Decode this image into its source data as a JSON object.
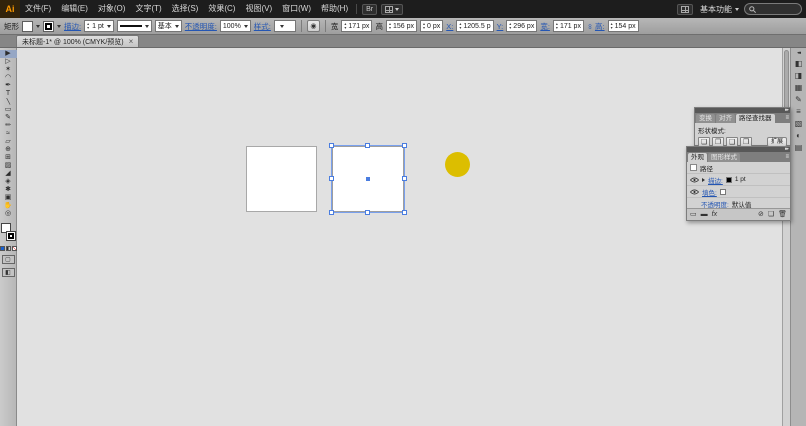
{
  "app": {
    "name": "Adobe Illustrator",
    "colors": {
      "selection_blue": "#4a7de0",
      "link_blue": "#2456b3",
      "shape_yellow": "#dcbe00",
      "canvas_gray": "#e1e1e1",
      "menubar_black": "#1d1d1d"
    }
  },
  "menu_bar": {
    "logo_text": "Ai",
    "items": [
      "文件(F)",
      "编辑(E)",
      "对象(O)",
      "文字(T)",
      "选择(S)",
      "效果(C)",
      "视图(V)",
      "窗口(W)",
      "帮助(H)"
    ],
    "bridge_label": "Br",
    "workspace_label": "基本功能",
    "search_placeholder": ""
  },
  "control_bar": {
    "selection_type": "矩形",
    "stroke_label": "描边:",
    "stroke_value": "1 pt",
    "brush_value": "基本",
    "opacity_label": "不透明度:",
    "opacity_value": "100%",
    "style_label": "样式:",
    "icons": {
      "constrain": "∞",
      "recolor": "◉"
    },
    "fields": [
      {
        "label": "宽",
        "value": "171 px"
      },
      {
        "label": "高",
        "value": "156 px"
      },
      {
        "label": "",
        "value": "0 px"
      },
      {
        "label": "X:",
        "value": "1205.5 p"
      },
      {
        "label": "Y:",
        "value": "296 px"
      },
      {
        "label": "宽:",
        "value": "171 px"
      },
      {
        "label": "高:",
        "value": "154 px"
      }
    ]
  },
  "document_tab": {
    "title": "未标题-1* @ 100% (CMYK/预览)",
    "close_label": "×"
  },
  "toolbar": {
    "tools": [
      {
        "name": "selection-tool",
        "glyph": "▶"
      },
      {
        "name": "direct-selection-tool",
        "glyph": "▷"
      },
      {
        "name": "magic-wand-tool",
        "glyph": "✶"
      },
      {
        "name": "lasso-tool",
        "glyph": "◠"
      },
      {
        "name": "pen-tool",
        "glyph": "✒"
      },
      {
        "name": "type-tool",
        "glyph": "T"
      },
      {
        "name": "line-segment-tool",
        "glyph": "╲"
      },
      {
        "name": "rectangle-tool",
        "glyph": "▭"
      },
      {
        "name": "paintbrush-tool",
        "glyph": "✎"
      },
      {
        "name": "pencil-tool",
        "glyph": "✏"
      },
      {
        "name": "width-tool",
        "glyph": "≈"
      },
      {
        "name": "free-transform-tool",
        "glyph": "▱"
      },
      {
        "name": "shape-builder-tool",
        "glyph": "⊕"
      },
      {
        "name": "mesh-tool",
        "glyph": "⊞"
      },
      {
        "name": "gradient-tool",
        "glyph": "▨"
      },
      {
        "name": "eyedropper-tool",
        "glyph": "◢"
      },
      {
        "name": "blend-tool",
        "glyph": "◈"
      },
      {
        "name": "symbol-sprayer-tool",
        "glyph": "✱"
      },
      {
        "name": "artboard-tool",
        "glyph": "▣"
      },
      {
        "name": "hand-tool",
        "glyph": "✋"
      },
      {
        "name": "zoom-tool",
        "glyph": "◎"
      }
    ]
  },
  "canvas": {
    "zoom": "100%",
    "shapes": [
      {
        "type": "rectangle",
        "fill": "#ffffff",
        "stroke": "#a8a8a8",
        "selected": false
      },
      {
        "type": "rectangle",
        "fill": "#ffffff",
        "stroke": "#9e9e9e",
        "selected": true
      },
      {
        "type": "ellipse",
        "fill": "#dcbe00",
        "selected": false
      }
    ]
  },
  "pathfinder_panel": {
    "tabs": [
      "变换",
      "对齐",
      "路径查找器"
    ],
    "active_tab": "路径查找器",
    "shape_modes_label": "形状模式:",
    "expand_button": "扩展",
    "shape_mode_icons": [
      {
        "name": "unite-icon",
        "glyph": "❏"
      },
      {
        "name": "minus-front-icon",
        "glyph": "❐"
      },
      {
        "name": "intersect-icon",
        "glyph": "❑"
      },
      {
        "name": "exclude-icon",
        "glyph": "❒"
      }
    ]
  },
  "appearance_panel": {
    "tabs": [
      "外观",
      "图形样式"
    ],
    "active_tab": "外观",
    "target_label": "路径",
    "stroke_row": {
      "label": "描边:",
      "value": "1 pt"
    },
    "fill_row": {
      "label": "填色:"
    },
    "opacity_row": {
      "label": "不透明度:",
      "value": "默认值"
    },
    "bottom_icons": [
      {
        "name": "add-new-stroke-icon",
        "glyph": "▭"
      },
      {
        "name": "add-new-fill-icon",
        "glyph": "▬"
      },
      {
        "name": "add-new-effect-icon",
        "glyph": "fx"
      },
      {
        "name": "clear-appearance-icon",
        "glyph": "⊘"
      },
      {
        "name": "duplicate-selected-item-icon",
        "glyph": "❏"
      },
      {
        "name": "delete-selected-item-icon",
        "glyph": "🗑"
      }
    ]
  },
  "dock": {
    "expand_glyph": "◂◂",
    "icons": [
      {
        "name": "color-panel-icon",
        "glyph": "◧"
      },
      {
        "name": "color-guide-panel-icon",
        "glyph": "◨"
      },
      {
        "name": "swatches-panel-icon",
        "glyph": "▦"
      },
      {
        "name": "brushes-panel-icon",
        "glyph": "✎"
      },
      {
        "name": "stroke-panel-icon",
        "glyph": "≡"
      },
      {
        "name": "gradient-panel-icon",
        "glyph": "▧"
      },
      {
        "name": "transparency-panel-icon",
        "glyph": "◐"
      },
      {
        "name": "layers-panel-icon",
        "glyph": "▤"
      }
    ]
  }
}
